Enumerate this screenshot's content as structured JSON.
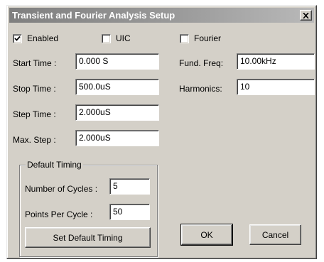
{
  "window": {
    "title": "Transient and Fourier Analysis Setup",
    "close_icon": "close-icon"
  },
  "options": {
    "enabled": {
      "label": "Enabled",
      "checked": true
    },
    "uic": {
      "label": "UIC",
      "checked": false
    },
    "fourier": {
      "label": "Fourier",
      "checked": false
    }
  },
  "fields": {
    "start_time": {
      "label": "Start Time :",
      "value": "0.000 S"
    },
    "stop_time": {
      "label": "Stop Time :",
      "value": "500.0uS"
    },
    "step_time": {
      "label": "Step Time :",
      "value": "2.000uS"
    },
    "max_step": {
      "label": "Max. Step :",
      "value": "2.000uS"
    },
    "fund_freq": {
      "label": "Fund. Freq:",
      "value": "10.00kHz"
    },
    "harmonics": {
      "label": "Harmonics:",
      "value": "10"
    }
  },
  "default_timing": {
    "legend": "Default Timing",
    "cycles": {
      "label": "Number of Cycles :",
      "value": "5"
    },
    "points": {
      "label": "Points Per Cycle :",
      "value": "50"
    },
    "set_button": "Set Default Timing"
  },
  "buttons": {
    "ok": "OK",
    "cancel": "Cancel"
  }
}
